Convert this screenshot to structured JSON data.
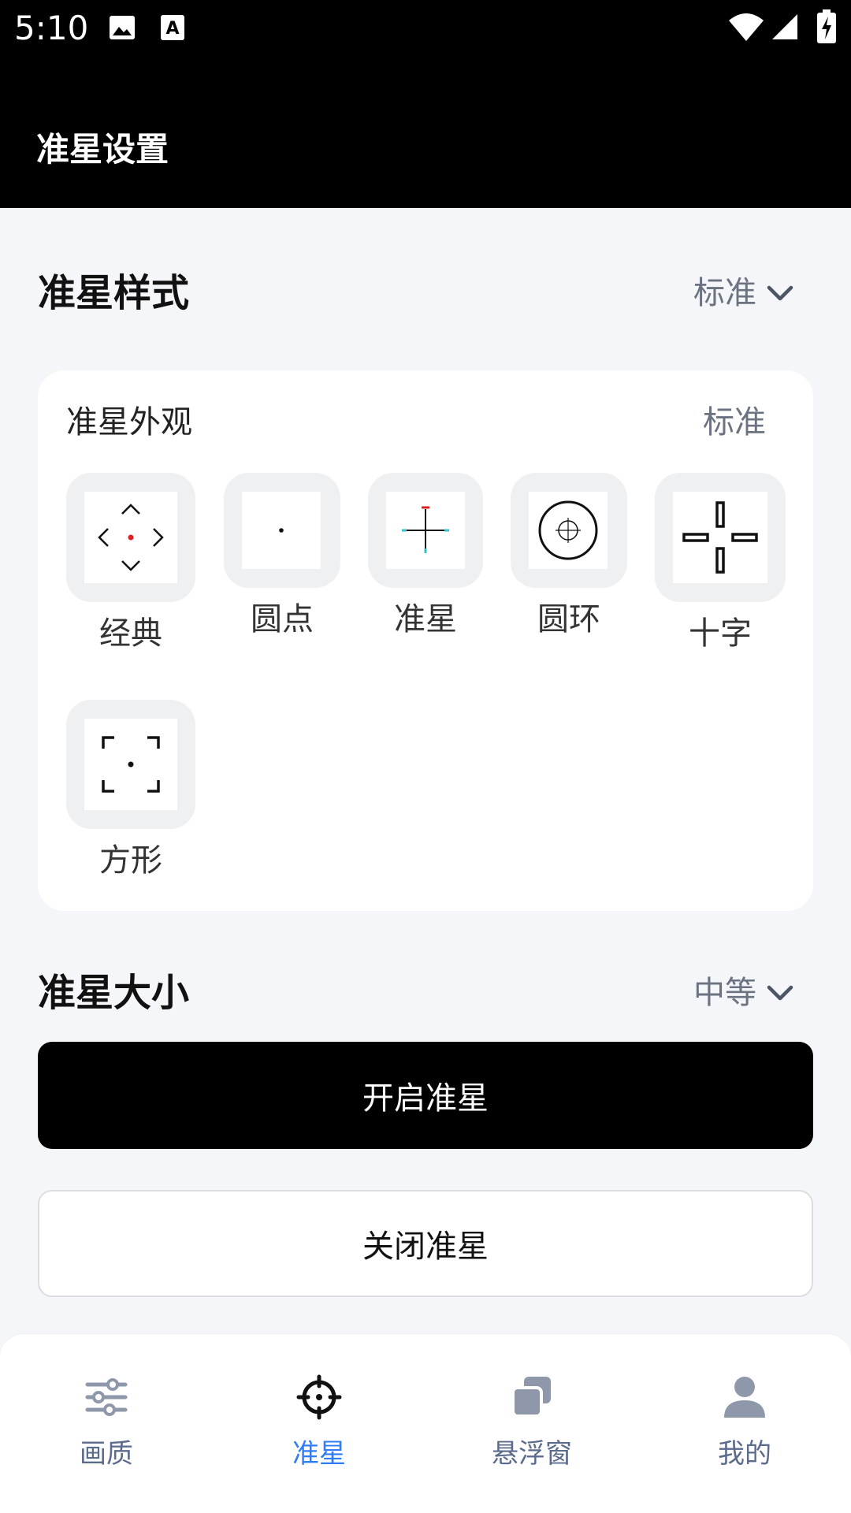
{
  "status_bar": {
    "time": "5:10",
    "left_icons": [
      "image-icon",
      "text-a-icon"
    ],
    "right_icons": [
      "wifi-icon",
      "signal-icon",
      "battery-charging-icon"
    ]
  },
  "header": {
    "title": "准星设置"
  },
  "style_section": {
    "title": "准星样式",
    "dropdown_value": "标准",
    "card": {
      "title": "准星外观",
      "value": "标准",
      "items": [
        {
          "label": "经典",
          "icon": "classic-crosshair-icon"
        },
        {
          "label": "圆点",
          "icon": "dot-crosshair-icon"
        },
        {
          "label": "准星",
          "icon": "cross-crosshair-icon"
        },
        {
          "label": "圆环",
          "icon": "ring-crosshair-icon"
        },
        {
          "label": "十字",
          "icon": "plus-crosshair-icon"
        },
        {
          "label": "方形",
          "icon": "square-crosshair-icon"
        }
      ]
    }
  },
  "size_section": {
    "title": "准星大小",
    "dropdown_value": "中等"
  },
  "buttons": {
    "enable": "开启准星",
    "disable": "关闭准星"
  },
  "bottom_nav": {
    "items": [
      {
        "label": "画质",
        "icon": "sliders-icon",
        "active": false
      },
      {
        "label": "准星",
        "icon": "crosshair-icon",
        "active": true
      },
      {
        "label": "悬浮窗",
        "icon": "floating-window-icon",
        "active": false
      },
      {
        "label": "我的",
        "icon": "user-icon",
        "active": false
      }
    ],
    "active_color": "#2f7df6",
    "inactive_color": "#5b6b8c"
  }
}
